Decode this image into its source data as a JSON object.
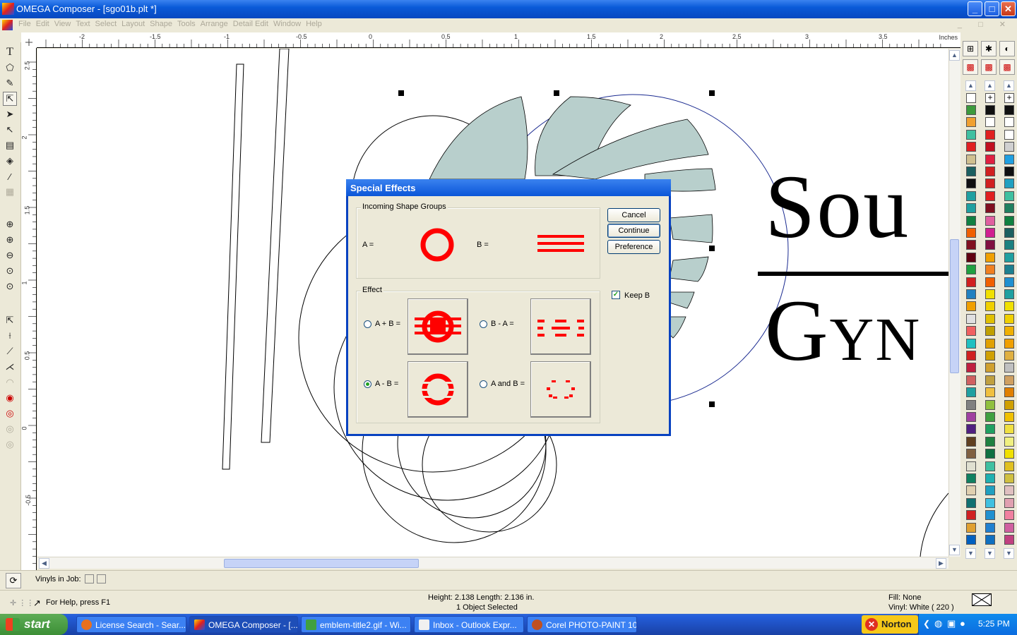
{
  "window": {
    "title": "OMEGA Composer - [sgo01b.plt *]",
    "controls": {
      "minimize": "_",
      "maximize": "□",
      "close": "✕"
    }
  },
  "menu": [
    "File",
    "Edit",
    "View",
    "Text",
    "Select",
    "Layout",
    "Shape",
    "Tools",
    "Arrange",
    "Detail Edit",
    "Window",
    "Help"
  ],
  "ruler": {
    "units": "Inches",
    "top_labels": [
      "-2",
      "-1.5",
      "-1",
      "-0.5",
      "0",
      "0.5",
      "1",
      "1.5",
      "2",
      "2.5",
      "3",
      "3.5"
    ],
    "left_labels": [
      "2.5",
      "2",
      "1.5",
      "1",
      "0.5",
      "0",
      "-0.5"
    ]
  },
  "canvas": {
    "text_line1": "Sou",
    "text_line2": "Gyn"
  },
  "dialog": {
    "title": "Special Effects",
    "incoming_group": "Incoming Shape Groups",
    "a_label": "A =",
    "b_label": "B =",
    "effect_group": "Effect",
    "options": [
      {
        "label": "A + B =",
        "selected": false
      },
      {
        "label": "B - A =",
        "selected": false
      },
      {
        "label": "A - B =",
        "selected": true
      },
      {
        "label": "A and B =",
        "selected": false
      }
    ],
    "buttons": {
      "cancel": "Cancel",
      "continue": "Continue",
      "preference": "Preference"
    },
    "keep_b": {
      "label": "Keep B",
      "checked": true
    },
    "accent_color": "#ff0000"
  },
  "bottom": {
    "vinyls_label": "Vinyls in Job:"
  },
  "status": {
    "help": "For Help, press F1",
    "dimensions": "Height: 2.138  Length: 2.136  in.",
    "selection": "1 Object Selected",
    "fill": "Fill: None",
    "vinyl": "Vinyl: White ( 220 )"
  },
  "taskbar": {
    "start": "start",
    "tasks": [
      {
        "label": "License Search - Sear...",
        "active": false
      },
      {
        "label": "OMEGA Composer - [...",
        "active": true
      },
      {
        "label": "emblem-title2.gif - Wi...",
        "active": false
      },
      {
        "label": "Inbox - Outlook Expr...",
        "active": false
      },
      {
        "label": "Corel PHOTO-PAINT 10",
        "active": false
      }
    ],
    "norton": "Norton",
    "clock": "5:25 PM"
  },
  "palette_colors": {
    "col1": [
      "#3c9a3c",
      "#f0a030",
      "#40c0a0",
      "#e02020",
      "#d0c090",
      "#1c6060",
      "#101010",
      "#20a0a0",
      "#20a0a0",
      "#108040",
      "#f06000",
      "#801020",
      "#600010",
      "#20a040",
      "#d02020",
      "#2080c0",
      "#f0a000",
      "#e0e0e0",
      "#f06060",
      "#20c0c0",
      "#d02020",
      "#c02040",
      "#d06060",
      "#20a0a0",
      "#808080",
      "#a040a0",
      "#502080",
      "#604020",
      "#806040",
      "#e0e0d0",
      "#108060",
      "#e0d0b0",
      "#107070",
      "#d02020",
      "#e0a030",
      "#0060c0"
    ],
    "col2": [
      "#101010",
      "#ffffff",
      "#e02020",
      "#c01020",
      "#e02040",
      "#d02020",
      "#d02020",
      "#e02020",
      "#801020",
      "#e060a0",
      "#d02090",
      "#801040",
      "#f0a000",
      "#f08020",
      "#f06000",
      "#f0e000",
      "#f0d000",
      "#e0c000",
      "#c0a000",
      "#e0a000",
      "#d0a000",
      "#d0a030",
      "#c0a040",
      "#f0c040",
      "#90c040",
      "#40a040",
      "#20a060",
      "#208040",
      "#107040",
      "#40c0a0",
      "#20b0b0",
      "#20a0c0",
      "#40c0e0",
      "#2090d0",
      "#2080d0",
      "#1070c0"
    ],
    "col3": [
      "#101010",
      "#ffffff",
      "#ffffff",
      "#d0d0d0",
      "#20a0e0",
      "#101010",
      "#20a0c0",
      "#40c0a0",
      "#208060",
      "#108040",
      "#1c6060",
      "#1c8080",
      "#20a0a0",
      "#1c8090",
      "#2090d0",
      "#20a0a0",
      "#f0e000",
      "#f0d000",
      "#f0b000",
      "#f0a000",
      "#e0b040",
      "#c0c0c0",
      "#d0a060",
      "#e08000",
      "#d0a000",
      "#f0c000",
      "#f0e040",
      "#f0f080",
      "#f0e000",
      "#e0c020",
      "#d0c040",
      "#e0c0c0",
      "#e0a0b0",
      "#f080a0",
      "#d060a0",
      "#c04080"
    ]
  }
}
